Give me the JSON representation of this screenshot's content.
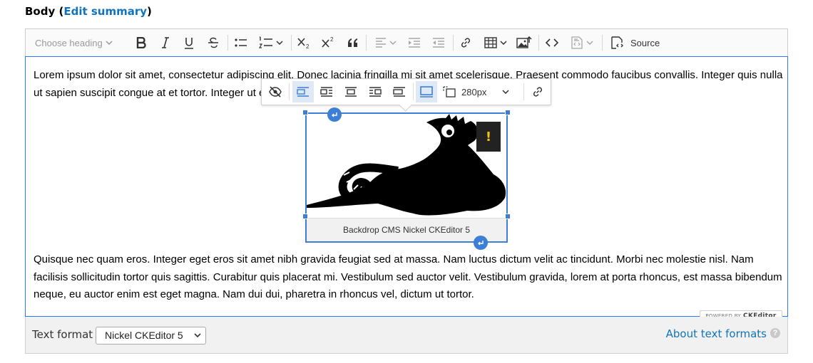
{
  "field": {
    "label": "Body",
    "open_paren": "(",
    "edit_summary": "Edit summary",
    "close_paren": ")"
  },
  "toolbar": {
    "heading_placeholder": "Choose heading",
    "source_label": "Source"
  },
  "content": {
    "paragraph1": "Lorem ipsum dolor sit amet, consectetur adipiscing elit. Donec lacinia fringilla mi sit amet scelerisque. Praesent commodo faucibus convallis. Integer quis nulla ut sapien suscipit congue at et tortor. Integer ut eros, et iaculis est felis vitae tellus.",
    "paragraph2": "Quisque nec quam eros. Integer eget eros sit amet nibh gravida feugiat sed at massa. Nam luctus dictum velit ac tincidunt. Morbi nec molestie nisl. Nam facilisis sollicitudin tortor quis sagittis. Curabitur quis placerat mi. Vestibulum sed auctor velit. Vestibulum gravida, lorem at porta rhoncus, est massa bibendum neque, eu auctor enim est eget magna. Nam dui dui, pharetra in rhoncus vel, dictum ut tortor."
  },
  "image": {
    "caption": "Backdrop CMS Nickel CKEditor 5",
    "warning": "!"
  },
  "image_toolbar": {
    "width_value": "280px"
  },
  "powered_by": {
    "prefix": "POWERED BY",
    "brand": "CKEditor"
  },
  "footer": {
    "text_format_label": "Text format",
    "text_format_value": "Nickel CKEditor 5",
    "about_link": "About text formats",
    "help": "?"
  },
  "colors": {
    "link": "#0f74bd",
    "focus_border": "#2977ff",
    "selected": "#3d7fd6"
  }
}
